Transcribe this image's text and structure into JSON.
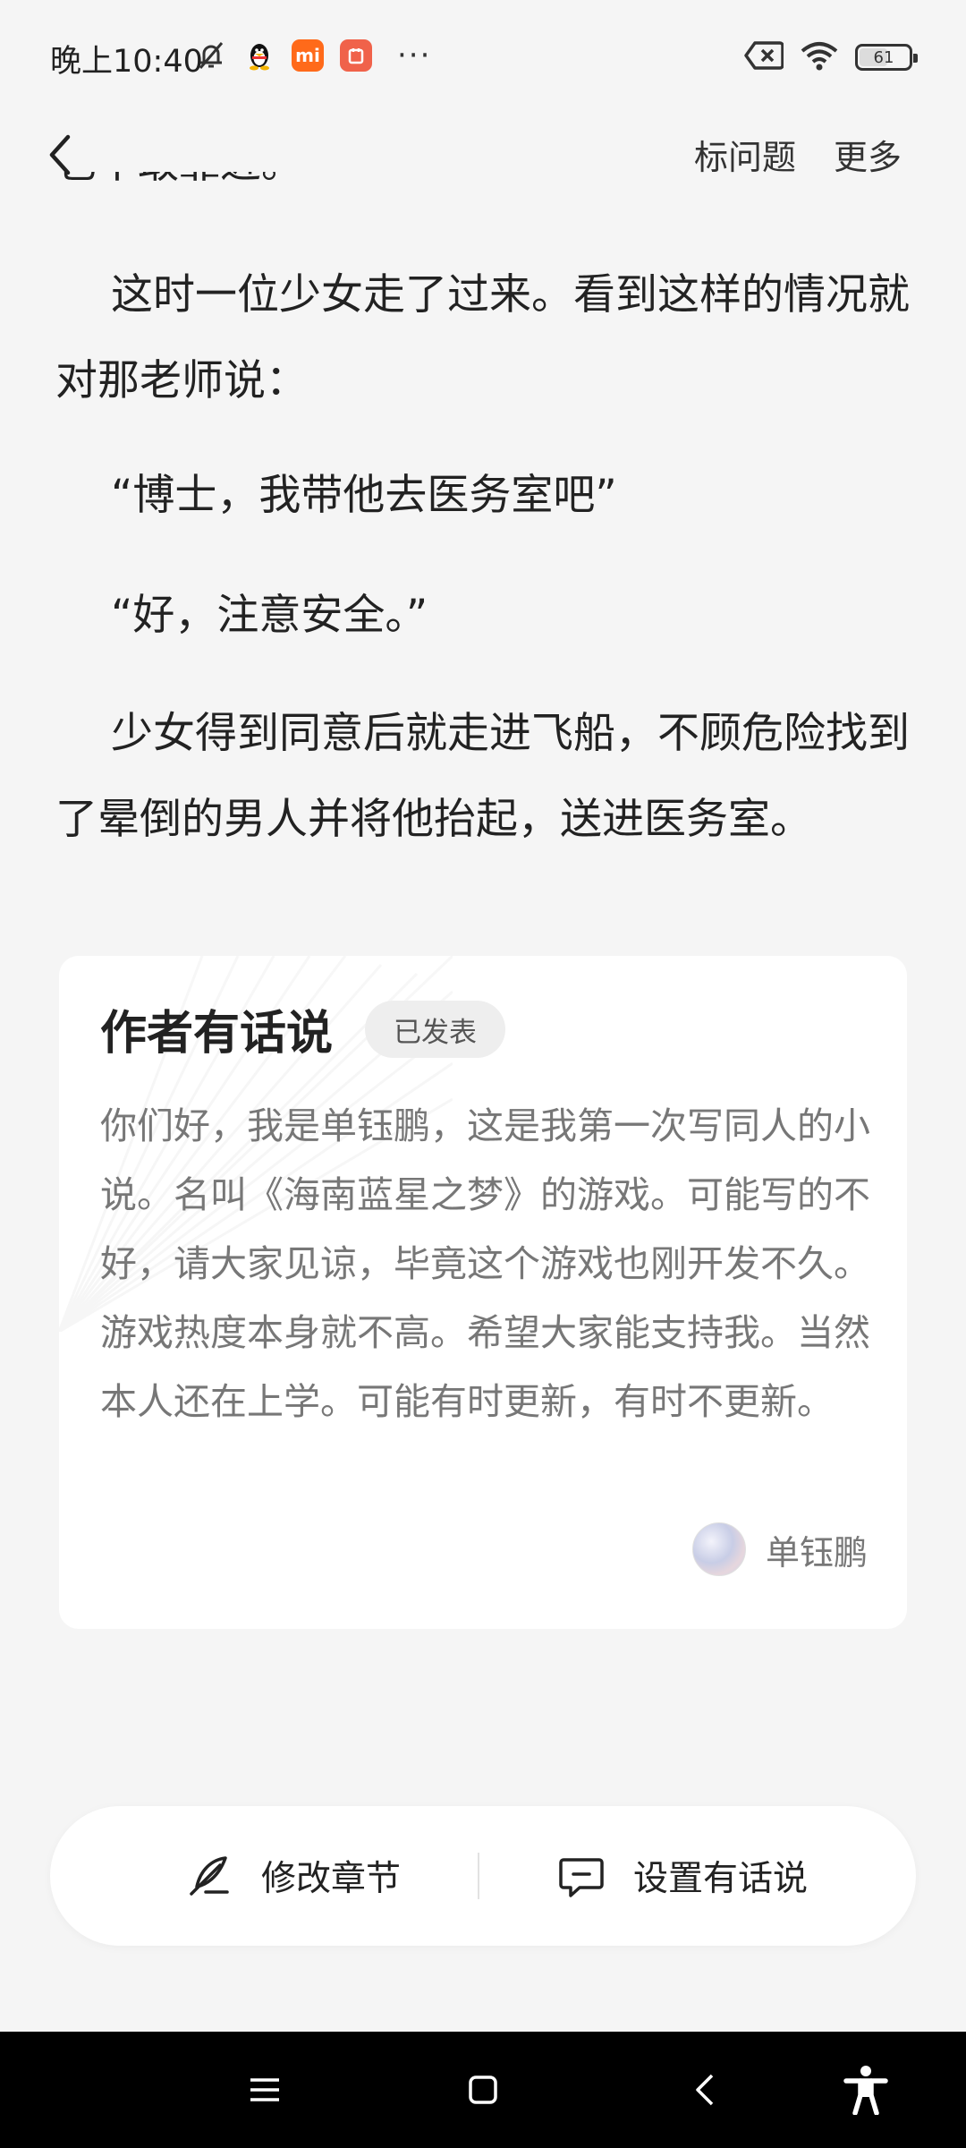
{
  "status_bar": {
    "time": "晚上10:40",
    "mi_label": "mi",
    "more_dots": "···",
    "battery_level": "61",
    "battery_fraction": 0.61
  },
  "nav": {
    "mark_issue": "标问题",
    "more": "更多"
  },
  "content": {
    "partial_top_line": "也不敢靠近。",
    "paragraphs": [
      "这时一位少女走了过来。看到这样的情况就对那老师说：",
      "“博士，我带他去医务室吧”",
      "“好，注意安全。”",
      "少女得到同意后就走进飞船，不顾危险找到了晕倒的男人并将他抬起，送进医务室。"
    ]
  },
  "author_note": {
    "title": "作者有话说",
    "status": "已发表",
    "body": "你们好，我是单钰鹏，这是我第一次写同人的小说。名叫《海南蓝星之梦》的游戏。可能写的不好，请大家见谅，毕竟这个游戏也刚开发不久。游戏热度本身就不高。希望大家能支持我。当然本人还在上学。可能有时更新，有时不更新。",
    "author_name": "单钰鹏"
  },
  "actions": {
    "edit_chapter": "修改章节",
    "set_note": "设置有话说"
  },
  "icons": {
    "status_left": [
      "mute-bell-icon",
      "qq-penguin-icon",
      "mi-app-icon",
      "app-notice-icon"
    ],
    "status_right": [
      "sim-off-icon",
      "wifi-icon",
      "battery-icon"
    ],
    "system_nav": [
      "menu-icon",
      "home-icon",
      "back-icon",
      "accessibility-icon"
    ]
  }
}
